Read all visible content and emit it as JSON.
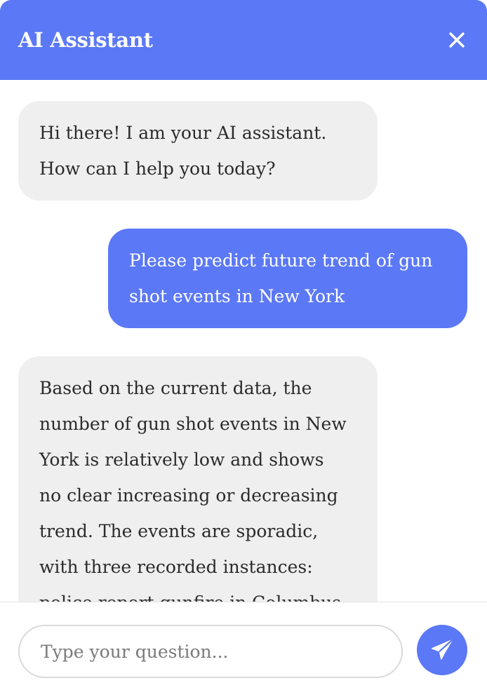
{
  "header": {
    "title": "AI Assistant",
    "close_icon": "close-icon"
  },
  "messages": [
    {
      "role": "assistant",
      "lines": [
        "Hi there! I am your AI assistant.",
        "How can I help you today?"
      ]
    },
    {
      "role": "user",
      "lines": [
        "Please predict future trend of gun",
        "shot events in New York"
      ]
    },
    {
      "role": "assistant",
      "lines": [
        "Based on the current data, the",
        "number of gun shot events in New",
        "York is relatively low and shows",
        "no clear increasing or decreasing",
        "trend. The events are sporadic,",
        "with three recorded instances:",
        "police report gunfire in Columbus"
      ]
    }
  ],
  "composer": {
    "placeholder": "Type your question...",
    "value": "",
    "send_icon": "send-icon"
  },
  "colors": {
    "accent": "#5b78f6",
    "bot_bubble": "#efefef",
    "text": "#2b2b2b"
  }
}
